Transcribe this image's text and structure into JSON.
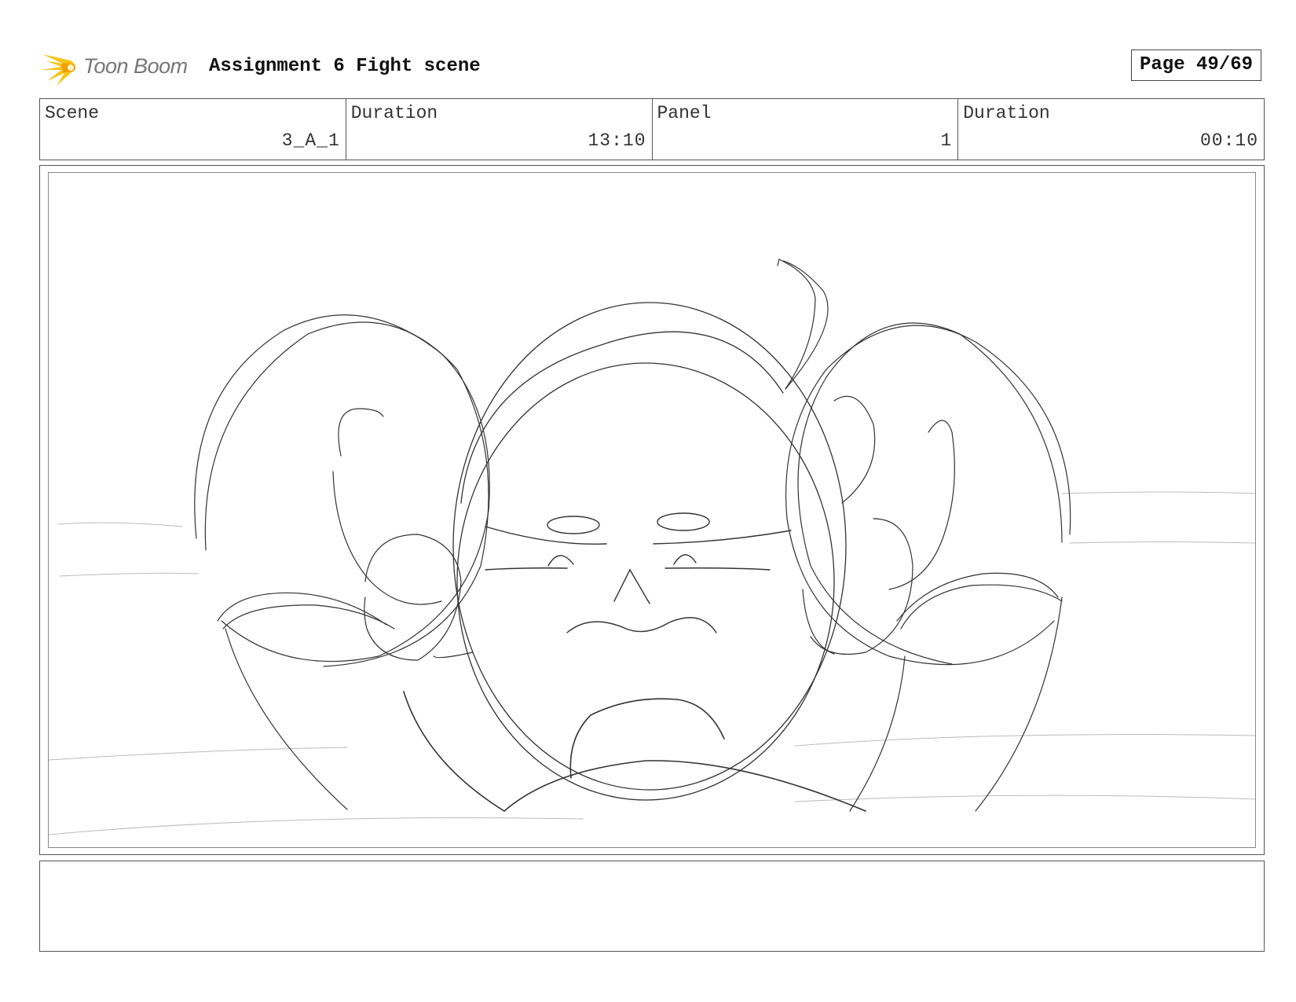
{
  "header": {
    "logo_text": "Toon Boom",
    "title": "Assignment 6 Fight scene",
    "page": "Page 49/69"
  },
  "info": {
    "scene_label": "Scene",
    "scene_value": "3_A_1",
    "scene_duration_label": "Duration",
    "scene_duration_value": "13:10",
    "panel_label": "Panel",
    "panel_value": "1",
    "panel_duration_label": "Duration",
    "panel_duration_value": "00:10"
  },
  "notes": {
    "text": ""
  },
  "colors": {
    "logo_yellow": "#f5c518",
    "logo_orange": "#f0a000",
    "sketch_line": "#333333",
    "border": "#555555"
  },
  "icons": {
    "logo": "toon-boom-starburst-icon"
  }
}
